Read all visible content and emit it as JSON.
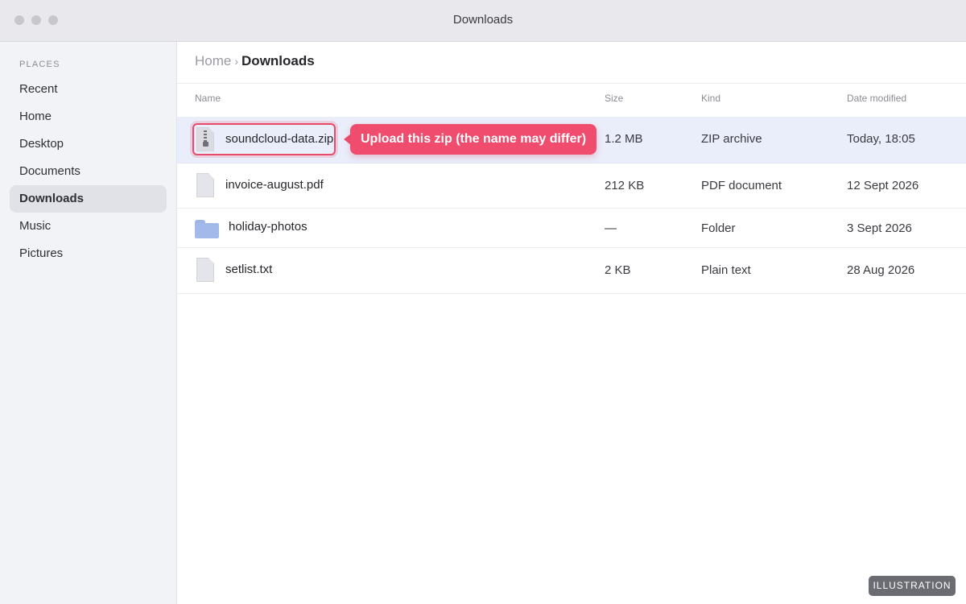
{
  "window": {
    "title": "Downloads"
  },
  "sidebar": {
    "heading": "PLACES",
    "items": [
      {
        "label": "Recent",
        "active": false
      },
      {
        "label": "Home",
        "active": false
      },
      {
        "label": "Desktop",
        "active": false
      },
      {
        "label": "Documents",
        "active": false
      },
      {
        "label": "Downloads",
        "active": true
      },
      {
        "label": "Music",
        "active": false
      },
      {
        "label": "Pictures",
        "active": false
      }
    ]
  },
  "breadcrumb": {
    "parent": "Home",
    "separator": "›",
    "current": "Downloads"
  },
  "columns": {
    "name": "Name",
    "size": "Size",
    "kind": "Kind",
    "date": "Date modified"
  },
  "files": [
    {
      "name": "soundcloud-data.zip",
      "size": "1.2 MB",
      "kind": "ZIP archive",
      "date": "Today, 18:05",
      "icon": "zip-file-icon",
      "selected": true
    },
    {
      "name": "invoice-august.pdf",
      "size": "212 KB",
      "kind": "PDF document",
      "date": "12 Sept 2026",
      "icon": "document-file-icon",
      "selected": false
    },
    {
      "name": "holiday-photos",
      "size": "—",
      "kind": "Folder",
      "date": "3 Sept 2026",
      "icon": "folder-icon",
      "selected": false
    },
    {
      "name": "setlist.txt",
      "size": "2 KB",
      "kind": "Plain text",
      "date": "28 Aug 2026",
      "icon": "document-file-icon",
      "selected": false
    }
  ],
  "callout": {
    "text": "Upload this zip (the name may differ)"
  },
  "badge": {
    "text": "ILLUSTRATION"
  },
  "colors": {
    "accent": "#ef4c6e",
    "selection": "#eaeefa",
    "folder": "#a3b9ea"
  }
}
